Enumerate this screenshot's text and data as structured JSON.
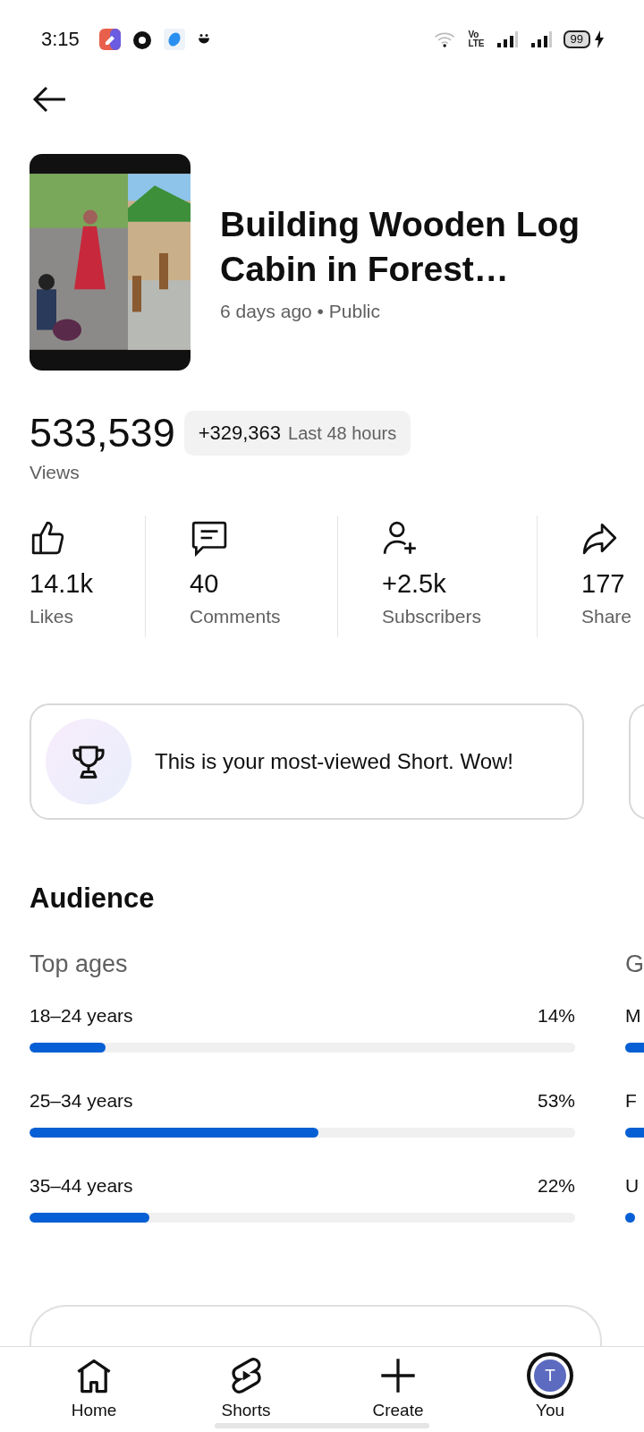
{
  "status_bar": {
    "time": "3:15",
    "network": [
      "Vo",
      "LTE"
    ],
    "battery": "99"
  },
  "video": {
    "title": "Building Wooden Log Cabin in Forest…",
    "meta": "6 days ago • Public"
  },
  "views": {
    "count": "533,539",
    "label": "Views",
    "change": "+329,363",
    "period": "Last 48 hours"
  },
  "stats": [
    {
      "kind": "like",
      "value": "14.1k",
      "label": "Likes"
    },
    {
      "kind": "comment",
      "value": "40",
      "label": "Comments"
    },
    {
      "kind": "subscriber",
      "value": "+2.5k",
      "label": "Subscribers"
    },
    {
      "kind": "share",
      "value": "177",
      "label": "Share"
    }
  ],
  "highlight": {
    "text": "This is your most-viewed Short. Wow!"
  },
  "audience": {
    "title": "Audience",
    "top_ages": {
      "title": "Top ages",
      "rows": [
        {
          "label": "18–24 years",
          "percent": "14%",
          "level": 0.14
        },
        {
          "label": "25–34 years",
          "percent": "53%",
          "level": 0.53
        },
        {
          "label": "35–44 years",
          "percent": "22%",
          "level": 0.22
        }
      ]
    },
    "column_2": {
      "title": "G",
      "rows": [
        {
          "label": "M"
        },
        {
          "label": "F"
        },
        {
          "label": "U"
        }
      ]
    }
  },
  "bottom_nav": [
    {
      "kind": "home",
      "label": "Home"
    },
    {
      "kind": "shorts",
      "label": "Shorts"
    },
    {
      "kind": "create",
      "label": "Create"
    },
    {
      "kind": "you",
      "label": "You",
      "avatar": "T"
    }
  ]
}
